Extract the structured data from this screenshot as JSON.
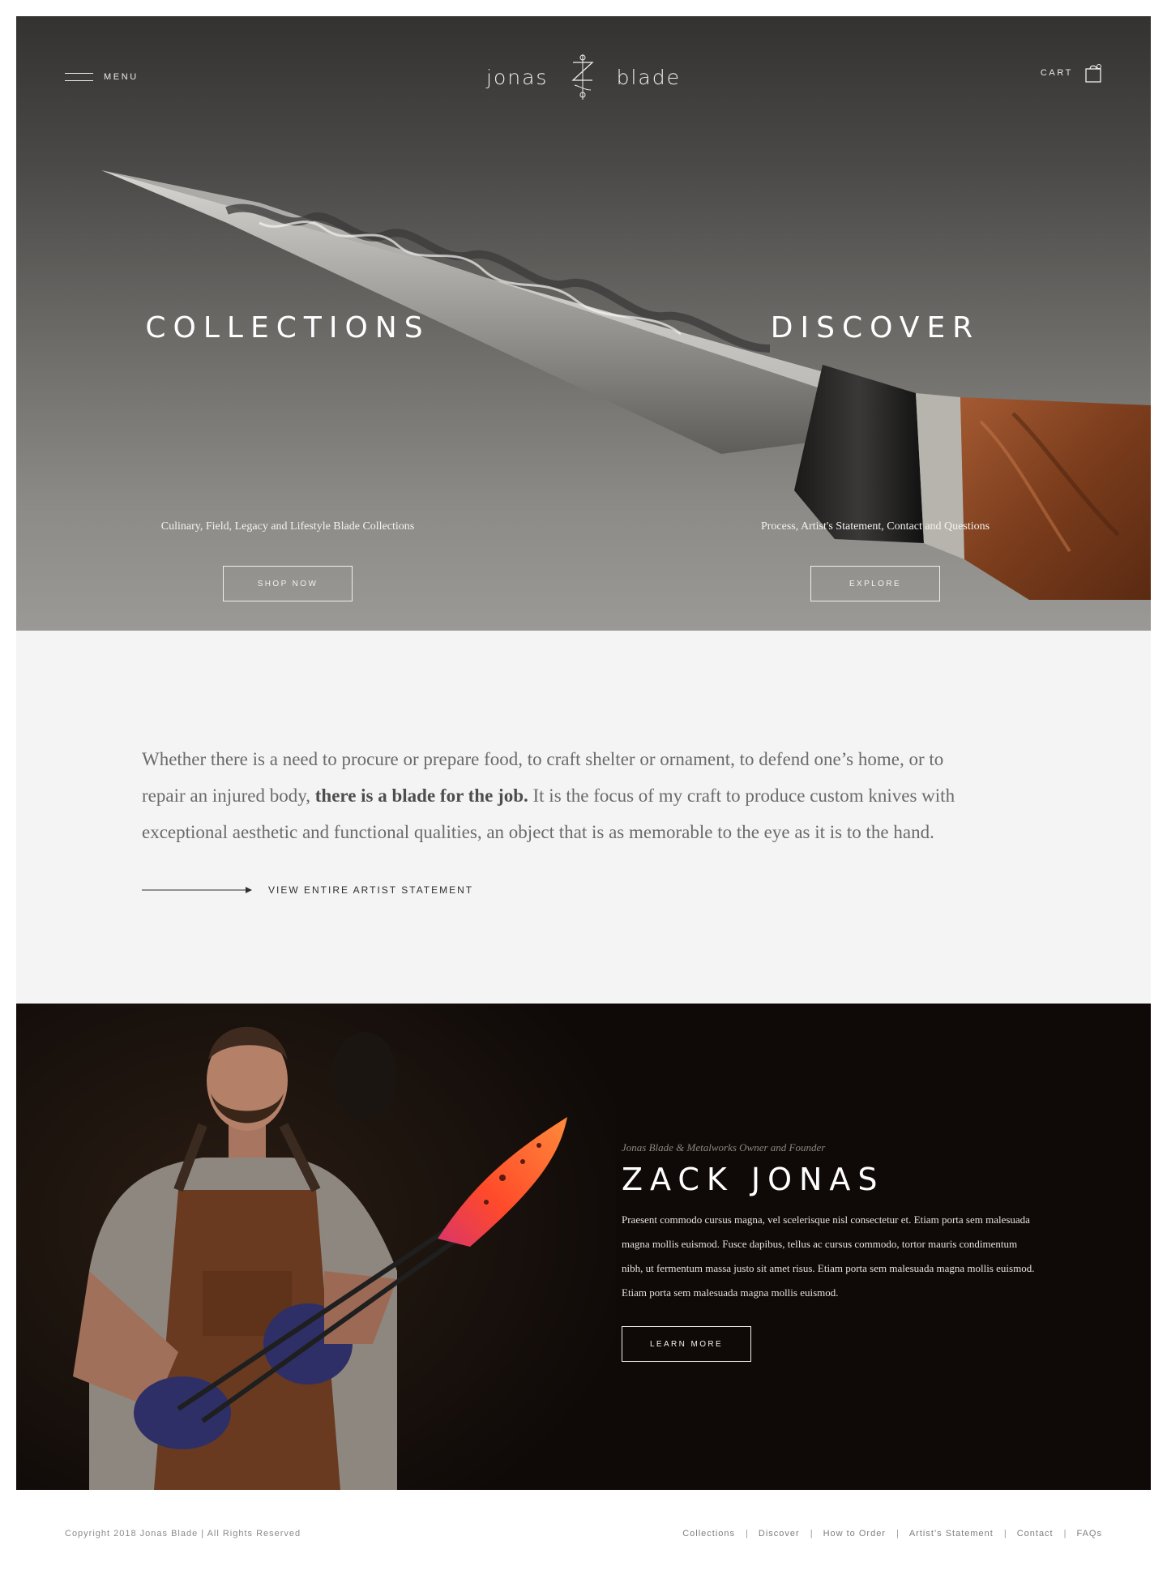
{
  "header": {
    "menu_label": "MENU",
    "logo_left": "jonas",
    "logo_right": "blade",
    "cart_label": "CART"
  },
  "hero": {
    "left": {
      "title": "COLLECTIONS",
      "subtitle": "Culinary, Field, Legacy and Lifestyle Blade Collections",
      "button": "SHOP NOW"
    },
    "right": {
      "title": "DISCOVER",
      "subtitle": "Process, Artist's Statement, Contact and Questions",
      "button": "EXPLORE"
    }
  },
  "statement": {
    "text_before": "Whether there is a need to procure or prepare food, to craft shelter or ornament, to defend one’s home, or to repair an injured body, ",
    "text_bold": "there is a blade for the job.",
    "text_after": " It is the focus of my craft to produce custom knives with exceptional aesthetic and functional qualities, an object that is as memorable to the eye as it is to the hand.",
    "link_label": "VIEW ENTIRE ARTIST STATEMENT"
  },
  "founder": {
    "role": "Jonas Blade & Metalworks Owner and Founder",
    "name": "ZACK JONAS",
    "bio": "Praesent commodo cursus magna, vel scelerisque nisl consectetur et. Etiam porta sem malesuada magna mollis euismod. Fusce dapibus, tellus ac cursus commodo, tortor mauris condimentum nibh, ut fermentum massa justo sit amet risus. Etiam porta sem malesuada magna mollis euismod. Etiam porta sem malesuada magna mollis euismod.",
    "button": "LEARN MORE"
  },
  "footer": {
    "copyright": "Copyright 2018 Jonas Blade | All Rights Reserved",
    "links": [
      "Collections",
      "Discover",
      "How to Order",
      "Artist’s Statement",
      "Contact",
      "FAQs"
    ],
    "separator": "|"
  },
  "icons": {
    "menu": "hamburger-icon",
    "logo_mark": "monogram-icon",
    "cart": "shopping-bag-icon",
    "arrow": "arrow-right-icon"
  },
  "colors": {
    "hero_top": "#333230",
    "hero_bottom": "#9a9995",
    "statement_bg": "#f4f4f4",
    "founder_bg": "#0f0a08",
    "glowing_blade": "#ff5a1f"
  }
}
